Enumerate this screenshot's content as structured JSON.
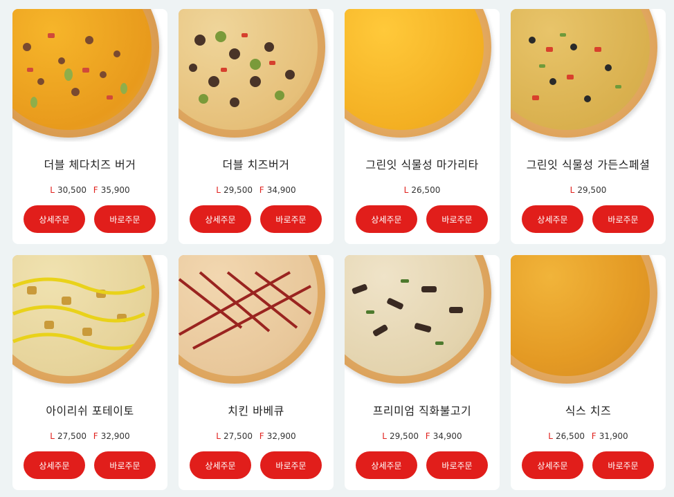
{
  "products": [
    {
      "name": "더블 체다치즈 버거",
      "prices": [
        {
          "size": "L",
          "amount": "30,500"
        },
        {
          "size": "F",
          "amount": "35,900"
        }
      ],
      "detail_label": "상세주문",
      "order_label": "바로주문",
      "topping": "cheddar-burger"
    },
    {
      "name": "더블 치즈버거",
      "prices": [
        {
          "size": "L",
          "amount": "29,500"
        },
        {
          "size": "F",
          "amount": "34,900"
        }
      ],
      "detail_label": "상세주문",
      "order_label": "바로주문",
      "topping": "cheeseburger"
    },
    {
      "name": "그린잇 식물성 마가리타",
      "prices": [
        {
          "size": "L",
          "amount": "26,500"
        }
      ],
      "detail_label": "상세주문",
      "order_label": "바로주문",
      "topping": "margherita"
    },
    {
      "name": "그린잇 식물성 가든스페셜",
      "prices": [
        {
          "size": "L",
          "amount": "29,500"
        }
      ],
      "detail_label": "상세주문",
      "order_label": "바로주문",
      "topping": "garden"
    },
    {
      "name": "아이리쉬 포테이토",
      "prices": [
        {
          "size": "L",
          "amount": "27,500"
        },
        {
          "size": "F",
          "amount": "32,900"
        }
      ],
      "detail_label": "상세주문",
      "order_label": "바로주문",
      "topping": "potato"
    },
    {
      "name": "치킨 바베큐",
      "prices": [
        {
          "size": "L",
          "amount": "27,500"
        },
        {
          "size": "F",
          "amount": "32,900"
        }
      ],
      "detail_label": "상세주문",
      "order_label": "바로주문",
      "topping": "bbq"
    },
    {
      "name": "프리미엄 직화불고기",
      "prices": [
        {
          "size": "L",
          "amount": "29,500"
        },
        {
          "size": "F",
          "amount": "34,900"
        }
      ],
      "detail_label": "상세주문",
      "order_label": "바로주문",
      "topping": "bulgogi"
    },
    {
      "name": "식스 치즈",
      "prices": [
        {
          "size": "L",
          "amount": "26,500"
        },
        {
          "size": "F",
          "amount": "31,900"
        }
      ],
      "detail_label": "상세주문",
      "order_label": "바로주문",
      "topping": "six-cheese"
    }
  ],
  "colors": {
    "accent": "#e11e1b",
    "size_label": "#e0201c",
    "background": "#eef3f4"
  }
}
